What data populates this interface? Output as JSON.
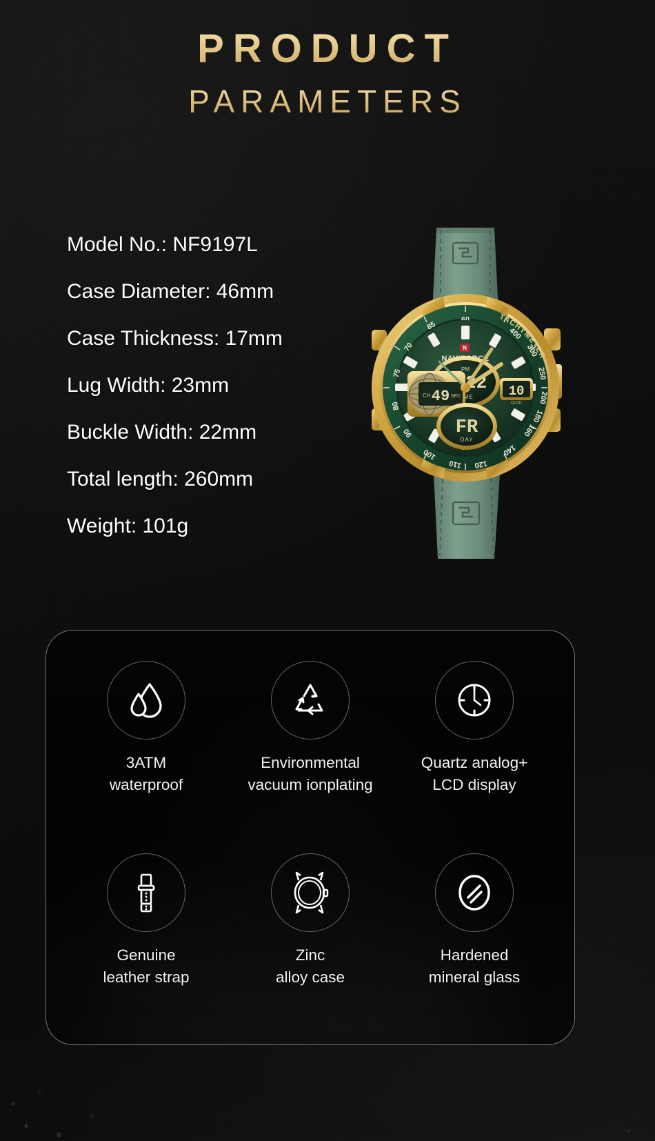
{
  "header": {
    "title_main": "PRODUCT",
    "title_sub": "PARAMETERS",
    "gold_color": "#e4c886"
  },
  "specs": {
    "items": [
      {
        "label": "Model No.: NF9197L"
      },
      {
        "label": "Case Diameter: 46mm"
      },
      {
        "label": "Case Thickness: 17mm"
      },
      {
        "label": "Lug Width: 23mm"
      },
      {
        "label": "Buckle Width: 22mm"
      },
      {
        "label": "Total length: 260mm"
      },
      {
        "label": "Weight: 101g"
      }
    ],
    "text_color": "#ffffff"
  },
  "product_image": {
    "name": "naviforce-green-gold-watch",
    "brand_text": "NAVIFORCE",
    "bezel_text": "TACHYMETER",
    "bezel_numbers": [
      "60",
      "85",
      "70",
      "75",
      "80",
      "90",
      "100",
      "110",
      "120",
      "140",
      "160",
      "180",
      "200",
      "250",
      "300",
      "400"
    ],
    "subdial_time": "6:22",
    "subdial_time_label": "TIME",
    "subdial_ampm": "PM",
    "subdial_seconds": "49",
    "subdial_seconds_label": "SEC",
    "subdial_seconds_ch": "CH",
    "subdial_date": "10",
    "subdial_date_label": "DATE",
    "subdial_day": "FR",
    "subdial_day_label": "DAY",
    "strap_color": "#6f8f7e",
    "case_color": "#d2a844",
    "dial_color": "#1d3b2a",
    "bezel_color": "#1f5136"
  },
  "features": {
    "rows": [
      [
        {
          "icon": "water-drops-icon",
          "line1": "3ATM",
          "line2": "waterproof"
        },
        {
          "icon": "recycle-icon",
          "line1": "Environmental",
          "line2": "vacuum ionplating"
        },
        {
          "icon": "clock-icon",
          "line1": "Quartz analog+",
          "line2": "LCD display"
        }
      ],
      [
        {
          "icon": "watch-strap-icon",
          "line1": "Genuine",
          "line2": "leather strap"
        },
        {
          "icon": "watch-case-icon",
          "line1": "Zinc",
          "line2": "alloy case"
        },
        {
          "icon": "mineral-glass-icon",
          "line1": "Hardened",
          "line2": "mineral glass"
        }
      ]
    ],
    "label_color": "#f2f2f2",
    "border_color": "#c8c8c8"
  },
  "background": {
    "color": "#0d0d0d"
  }
}
